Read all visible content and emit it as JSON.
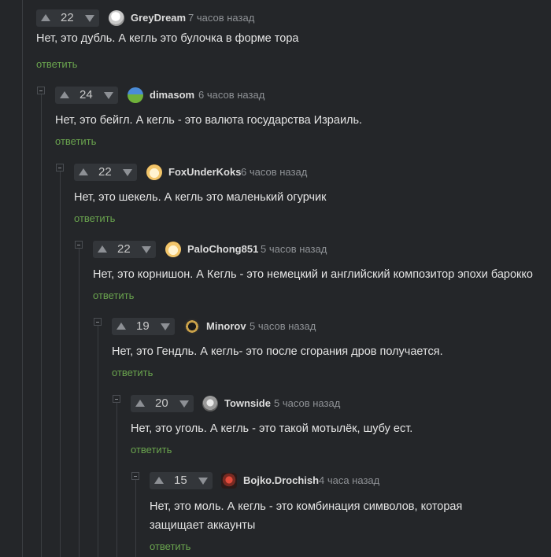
{
  "reply_label": "ответить",
  "colors": {
    "background": "#242629",
    "reply": "#6aa44e",
    "thread_line": "#3b3e42"
  },
  "comments": [
    {
      "votes": "22",
      "user": "GreyDream",
      "time": "7 часов назад",
      "avatar_icon": "avatar-greydream-icon",
      "text": "Нет, это дубль. А кегль это булочка в форме тора"
    },
    {
      "votes": "24",
      "user": "dimasom",
      "time": "6 часов назад",
      "avatar_icon": "avatar-dimasom-icon",
      "text": "Нет, это бейгл. А кегль - это валюта государства Израиль."
    },
    {
      "votes": "22",
      "user": "FoxUnderKoks",
      "time": "6 часов назад",
      "avatar_icon": "avatar-foxunderkoks-icon",
      "text": "Нет, это шекель. А кегль это маленький огурчик"
    },
    {
      "votes": "22",
      "user": "PaloChong851",
      "time": "5 часов назад",
      "avatar_icon": "avatar-palochong851-icon",
      "text": "Нет, это корнишон. А Кегль - это немецкий и английский композитор эпохи барокко"
    },
    {
      "votes": "19",
      "user": "Minorov",
      "time": "5 часов назад",
      "avatar_icon": "avatar-minorov-icon",
      "text": "Нет, это Гендль. А кегль- это после сгорания дров получается."
    },
    {
      "votes": "20",
      "user": "Townside",
      "time": "5 часов назад",
      "avatar_icon": "avatar-townside-icon",
      "text": "Нет, это уголь. А кегль - это такой мотылёк, шубу ест."
    },
    {
      "votes": "15",
      "user": "Bojko.Drochish",
      "time": "4 часа назад",
      "avatar_icon": "avatar-bojko-icon",
      "text_line1": "Нет, это моль. А кегль - это комбинация символов, которая",
      "text_line2": "защищает аккаунты"
    }
  ]
}
